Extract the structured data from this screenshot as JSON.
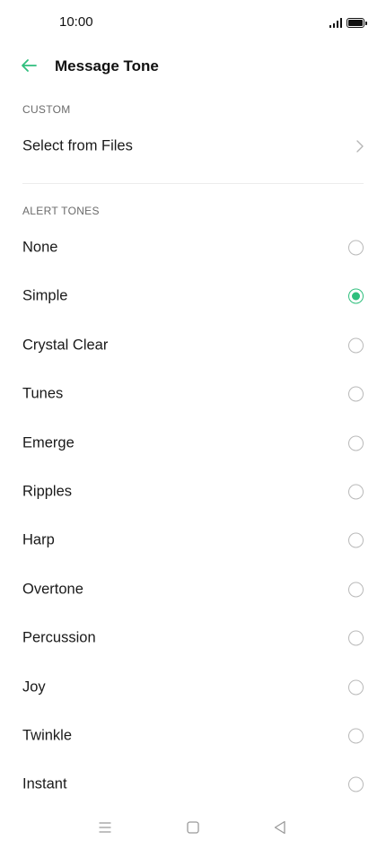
{
  "status_bar": {
    "time": "10:00"
  },
  "header": {
    "title": "Message Tone",
    "back_icon": "arrow-left-icon"
  },
  "custom_section": {
    "header": "CUSTOM",
    "item": {
      "label": "Select from Files",
      "icon": "chevron-right-icon"
    }
  },
  "alert_section": {
    "header": "ALERT TONES",
    "selected": "Simple",
    "tones": [
      {
        "label": "None",
        "selected": false
      },
      {
        "label": "Simple",
        "selected": true
      },
      {
        "label": "Crystal Clear",
        "selected": false
      },
      {
        "label": "Tunes",
        "selected": false
      },
      {
        "label": "Emerge",
        "selected": false
      },
      {
        "label": "Ripples",
        "selected": false
      },
      {
        "label": "Harp",
        "selected": false
      },
      {
        "label": "Overtone",
        "selected": false
      },
      {
        "label": "Percussion",
        "selected": false
      },
      {
        "label": "Joy",
        "selected": false
      },
      {
        "label": "Twinkle",
        "selected": false
      },
      {
        "label": "Instant",
        "selected": false
      }
    ]
  },
  "nav_bar": {
    "menu_icon": "menu-icon",
    "home_icon": "home-square-icon",
    "back_icon": "back-triangle-icon"
  },
  "colors": {
    "accent": "#2fbf7d",
    "text": "#1a1a1a",
    "secondary_text": "#6b6b6b",
    "divider": "#ececec"
  }
}
